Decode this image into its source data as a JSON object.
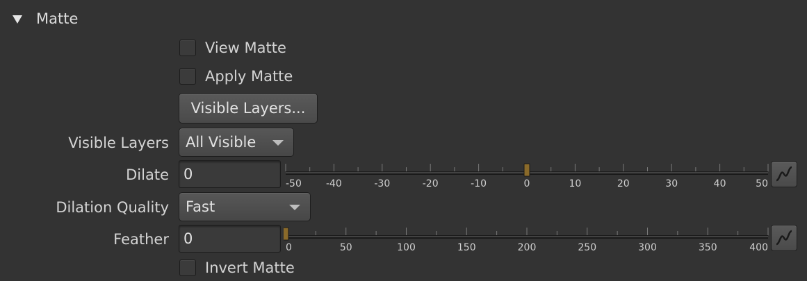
{
  "section": {
    "title": "Matte",
    "expanded": true
  },
  "view_matte": {
    "label": "View Matte",
    "checked": false
  },
  "apply_matte": {
    "label": "Apply Matte",
    "checked": false
  },
  "visible_layers_button": {
    "label": "Visible Layers..."
  },
  "visible_layers": {
    "label": "Visible Layers",
    "value": "All Visible"
  },
  "dilate": {
    "label": "Dilate",
    "value": "0",
    "slider": {
      "min": -50,
      "max": 50,
      "value": 0,
      "ticks": [
        -50,
        -40,
        -30,
        -20,
        -10,
        0,
        10,
        20,
        30,
        40,
        50
      ],
      "tick_labels": [
        "-50",
        "-40",
        "-30",
        "-20",
        "-10",
        "0",
        "10",
        "20",
        "30",
        "40",
        "50"
      ]
    },
    "curve_icon": "curve-icon"
  },
  "dilation_quality": {
    "label": "Dilation Quality",
    "value": "Fast"
  },
  "feather": {
    "label": "Feather",
    "value": "0",
    "slider": {
      "min": 0,
      "max": 400,
      "value": 0,
      "ticks": [
        0,
        50,
        100,
        150,
        200,
        250,
        300,
        350,
        400
      ],
      "tick_labels": [
        "0",
        "50",
        "100",
        "150",
        "200",
        "250",
        "300",
        "350",
        "400"
      ]
    },
    "curve_icon": "curve-icon"
  },
  "invert_matte": {
    "label": "Invert Matte",
    "checked": false
  },
  "colors": {
    "background": "#333333",
    "handle": "#8a6a2a",
    "text": "#d4d4d4"
  }
}
